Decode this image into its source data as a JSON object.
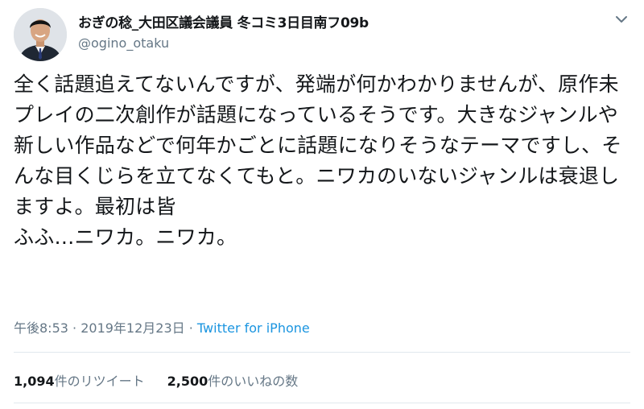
{
  "user": {
    "display_name": "おぎの稔_大田区議会議員 冬コミ3日目南フ09b",
    "handle": "@ogino_otaku",
    "avatar_icon": "profile-photo"
  },
  "menu_icon": "chevron-down-icon",
  "tweet": {
    "text": "全く話題追えてないんですが、発端が何かわかりませんが、原作未プレイの二次創作が話題になっているそうです。大きなジャンルや新しい作品などで何年かごとに話題になりそうなテーマですし、そんな目くじらを立てなくてもと。ニワカのいないジャンルは衰退しますよ。最初は皆\nふふ…ニワカ。ニワカ。",
    "time": "午後8:53",
    "separator": " · ",
    "date": "2019年12月23日",
    "source": "Twitter for iPhone"
  },
  "stats": {
    "retweets_count": "1,094",
    "retweets_label": "件のリツイート",
    "likes_count": "2,500",
    "likes_label": "件のいいねの数"
  },
  "colors": {
    "text": "#14171a",
    "secondary": "#657786",
    "link": "#1b95e0",
    "divider": "#e1e8ed"
  }
}
